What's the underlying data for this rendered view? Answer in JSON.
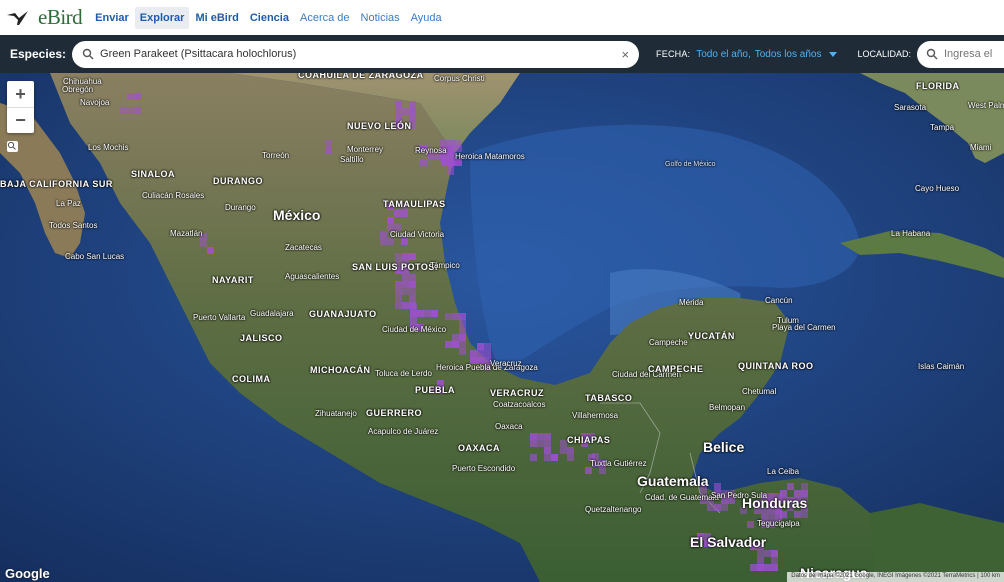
{
  "nav": {
    "brand": "eBird",
    "items": [
      {
        "label": "Enviar",
        "style": "bold"
      },
      {
        "label": "Explorar",
        "style": "bold active"
      },
      {
        "label": "Mi eBird",
        "style": "bold"
      },
      {
        "label": "Ciencia",
        "style": "bold"
      },
      {
        "label": "Acerca de",
        "style": "light"
      },
      {
        "label": "Noticias",
        "style": "light"
      },
      {
        "label": "Ayuda",
        "style": "light"
      }
    ]
  },
  "filters": {
    "species_label": "Especies:",
    "species_value": "Green Parakeet (Psittacara holochlorus)",
    "clear_symbol": "×",
    "date_label": "FECHA:",
    "date_season": "Todo el año,",
    "date_years": "Todos los años",
    "location_label": "LOCALIDAD:",
    "location_placeholder": "Ingresa el"
  },
  "map": {
    "colors": {
      "ocean": "#1e3f7a",
      "land": "#4a6a3a",
      "observations": "#a24fd6"
    },
    "zoom_in": "+",
    "zoom_out": "−",
    "google": "Google",
    "attribution": "Datos del mapa ©2021 Google, INEGI Imágenes ©2021 TerraMetrics | 100 km",
    "labels": [
      {
        "text": "Chihuahua",
        "kind": "city"
      },
      {
        "text": "Obregón",
        "kind": "city"
      },
      {
        "text": "Navojoa",
        "kind": "city"
      },
      {
        "text": "Los Mochis",
        "kind": "city"
      },
      {
        "text": "BAJA CALIFORNIA SUR",
        "kind": "state"
      },
      {
        "text": "La Paz",
        "kind": "city"
      },
      {
        "text": "Todos Santos",
        "kind": "city"
      },
      {
        "text": "Cabo San Lucas",
        "kind": "city"
      },
      {
        "text": "SINALOA",
        "kind": "state"
      },
      {
        "text": "Culiacán Rosales",
        "kind": "city"
      },
      {
        "text": "Mazatlán",
        "kind": "city"
      },
      {
        "text": "DURANGO",
        "kind": "state"
      },
      {
        "text": "Durango",
        "kind": "city"
      },
      {
        "text": "Torreón",
        "kind": "city"
      },
      {
        "text": "COAHUILA DE ZARAGOZA",
        "kind": "state"
      },
      {
        "text": "NUEVO LEÓN",
        "kind": "state"
      },
      {
        "text": "Monterrey",
        "kind": "city"
      },
      {
        "text": "Saltillo",
        "kind": "city"
      },
      {
        "text": "Reynosa",
        "kind": "city"
      },
      {
        "text": "Heroica Matamoros",
        "kind": "city"
      },
      {
        "text": "Corpus Christi",
        "kind": "city"
      },
      {
        "text": "México",
        "kind": "country"
      },
      {
        "text": "TAMAULIPAS",
        "kind": "state"
      },
      {
        "text": "Ciudad Victoria",
        "kind": "city"
      },
      {
        "text": "Zacatecas",
        "kind": "city"
      },
      {
        "text": "SAN LUIS POTOSÍ",
        "kind": "state"
      },
      {
        "text": "Tampico",
        "kind": "city"
      },
      {
        "text": "NAYARIT",
        "kind": "state"
      },
      {
        "text": "Aguascalientes",
        "kind": "city"
      },
      {
        "text": "Puerto Vallarta",
        "kind": "city"
      },
      {
        "text": "Guadalajara",
        "kind": "city"
      },
      {
        "text": "GUANAJUATO",
        "kind": "state"
      },
      {
        "text": "JALISCO",
        "kind": "state"
      },
      {
        "text": "Ciudad de México",
        "kind": "city"
      },
      {
        "text": "COLIMA",
        "kind": "state"
      },
      {
        "text": "MICHOACÁN",
        "kind": "state"
      },
      {
        "text": "Toluca de Lerdo",
        "kind": "city"
      },
      {
        "text": "Heroica Puebla de Zaragoza",
        "kind": "city"
      },
      {
        "text": "PUEBLA",
        "kind": "state"
      },
      {
        "text": "Veracruz",
        "kind": "city"
      },
      {
        "text": "VERACRUZ",
        "kind": "state"
      },
      {
        "text": "Coatzacoalcos",
        "kind": "city"
      },
      {
        "text": "GUERRERO",
        "kind": "state"
      },
      {
        "text": "Zihuatanejo",
        "kind": "city"
      },
      {
        "text": "Acapulco de Juárez",
        "kind": "city"
      },
      {
        "text": "Oaxaca",
        "kind": "city"
      },
      {
        "text": "OAXACA",
        "kind": "state"
      },
      {
        "text": "Puerto Escondido",
        "kind": "city"
      },
      {
        "text": "TABASCO",
        "kind": "state"
      },
      {
        "text": "Villahermosa",
        "kind": "city"
      },
      {
        "text": "CHIAPAS",
        "kind": "state"
      },
      {
        "text": "Tuxtla Gutiérrez",
        "kind": "city"
      },
      {
        "text": "Golfo de México",
        "kind": "water"
      },
      {
        "text": "Mérida",
        "kind": "city"
      },
      {
        "text": "Cancún",
        "kind": "city"
      },
      {
        "text": "Tulum",
        "kind": "city"
      },
      {
        "text": "Playa del Carmen",
        "kind": "city"
      },
      {
        "text": "YUCATÁN",
        "kind": "state"
      },
      {
        "text": "Campeche",
        "kind": "city"
      },
      {
        "text": "Ciudad del Carmen",
        "kind": "city"
      },
      {
        "text": "CAMPECHE",
        "kind": "state"
      },
      {
        "text": "QUINTANA ROO",
        "kind": "state"
      },
      {
        "text": "Chetumal",
        "kind": "city"
      },
      {
        "text": "Belmopan",
        "kind": "city"
      },
      {
        "text": "Belice",
        "kind": "country"
      },
      {
        "text": "Guatemala",
        "kind": "country"
      },
      {
        "text": "Cdad. de Guatemala",
        "kind": "city"
      },
      {
        "text": "Quetzaltenango",
        "kind": "city"
      },
      {
        "text": "San Pedro Sula",
        "kind": "city"
      },
      {
        "text": "La Ceiba",
        "kind": "city"
      },
      {
        "text": "Honduras",
        "kind": "country"
      },
      {
        "text": "Tegucigalpa",
        "kind": "city"
      },
      {
        "text": "El Salvador",
        "kind": "country"
      },
      {
        "text": "Nicaragua",
        "kind": "country"
      },
      {
        "text": "Islas Caimán",
        "kind": "city"
      },
      {
        "text": "La Habana",
        "kind": "city"
      },
      {
        "text": "FLORIDA",
        "kind": "state"
      },
      {
        "text": "Sarasota",
        "kind": "city"
      },
      {
        "text": "West Palm Beach",
        "kind": "city"
      },
      {
        "text": "Miami",
        "kind": "city"
      },
      {
        "text": "Cayo Hueso",
        "kind": "city"
      },
      {
        "text": "Tampa",
        "kind": "city"
      }
    ]
  }
}
